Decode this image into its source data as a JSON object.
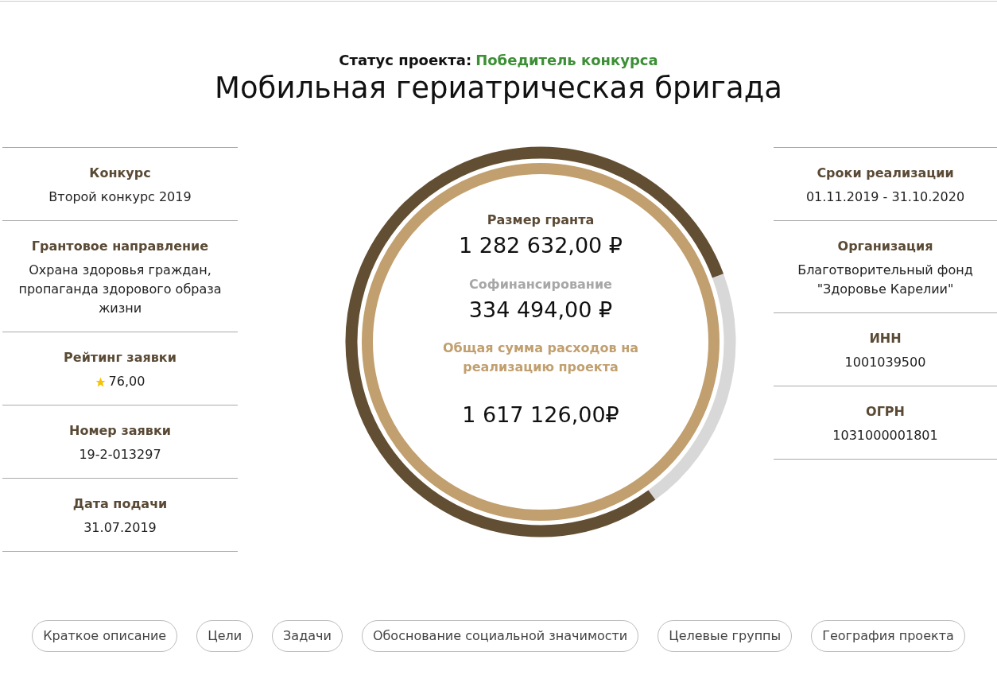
{
  "status": {
    "label": "Статус проекта:",
    "value": "Победитель конкурса"
  },
  "title": "Мобильная гериатрическая бригада",
  "left_fields": [
    {
      "kind": "text",
      "label": "Конкурс",
      "value": "Второй конкурс 2019"
    },
    {
      "kind": "text",
      "label": "Грантовое направление",
      "value": "Охрана здоровья граждан, пропаганда здорового образа жизни"
    },
    {
      "kind": "rating",
      "label": "Рейтинг заявки",
      "value": "76,00"
    },
    {
      "kind": "text",
      "label": "Номер заявки",
      "value": "19-2-013297"
    },
    {
      "kind": "text",
      "label": "Дата подачи",
      "value": "31.07.2019"
    }
  ],
  "funding_ring": {
    "grant": {
      "label": "Размер гранта",
      "value": "1 282 632,00 ₽"
    },
    "cofinancing": {
      "label": "Софинансирование",
      "value": "334 494,00 ₽"
    },
    "total": {
      "label": "Общая сумма расходов на реализацию проекта",
      "value": "1 617 126,00₽"
    }
  },
  "right_fields": [
    {
      "kind": "text",
      "label": "Сроки реализации",
      "value": "01.11.2019 - 31.10.2020"
    },
    {
      "kind": "text",
      "label": "Организация",
      "value": "Благотворительный фонд \"Здоровье Карелии\""
    },
    {
      "kind": "text",
      "label": "ИНН",
      "value": "1001039500"
    },
    {
      "kind": "text",
      "label": "ОГРН",
      "value": "1031000001801"
    }
  ],
  "tabs": [
    "Краткое описание",
    "Цели",
    "Задачи",
    "Обоснование социальной значимости",
    "Целевые группы",
    "География проекта"
  ]
}
